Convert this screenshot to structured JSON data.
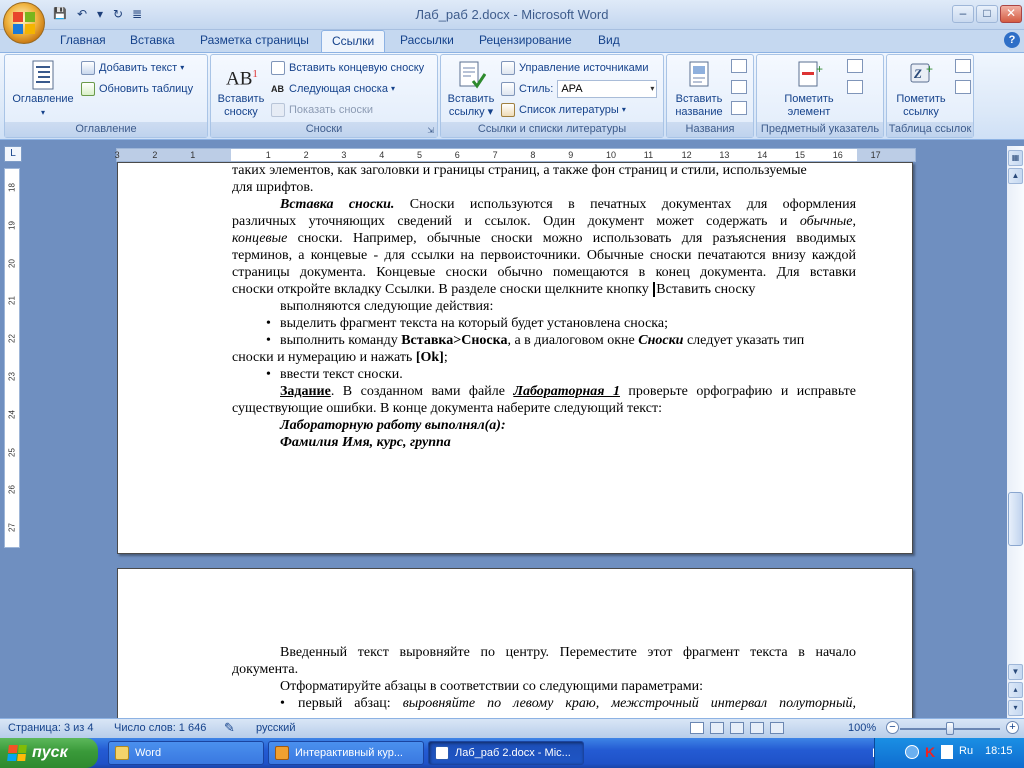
{
  "window": {
    "title": "Лаб_раб 2.docx - Microsoft Word",
    "minimize": "–",
    "maximize": "□",
    "close": "✕"
  },
  "qat": {
    "save": "💾",
    "undo": "↶",
    "dropdown": "▾",
    "redo": "↻",
    "customize": "≣"
  },
  "tabs": [
    "Главная",
    "Вставка",
    "Разметка страницы",
    "Ссылки",
    "Рассылки",
    "Рецензирование",
    "Вид"
  ],
  "active_tab": "Ссылки",
  "ribbon": {
    "toc": {
      "label": "Оглавление",
      "big": "Оглавление",
      "add_text": "Добавить текст",
      "update": "Обновить таблицу"
    },
    "footnotes": {
      "label": "Сноски",
      "insert_line1": "Вставить",
      "insert_line2": "сноску",
      "ab_glyph": "AB",
      "ab_sup": "1",
      "endnote": "Вставить концевую сноску",
      "next": "Следующая сноска",
      "show": "Показать сноски"
    },
    "citations": {
      "label": "Ссылки и списки литературы",
      "insert_line1": "Вставить",
      "insert_line2": "ссылку",
      "manage": "Управление источниками",
      "style_label": "Стиль:",
      "style_value": "APA",
      "bibliography": "Список литературы"
    },
    "captions": {
      "label": "Названия",
      "insert_line1": "Вставить",
      "insert_line2": "название"
    },
    "index": {
      "label": "Предметный указатель",
      "mark_line1": "Пометить",
      "mark_line2": "элемент"
    },
    "toa": {
      "label": "Таблица ссылок",
      "mark_line1": "Пометить",
      "mark_line2": "ссылку"
    }
  },
  "ruler": {
    "corner": "L",
    "marks": [
      "3",
      "2",
      "1",
      "1",
      "2",
      "3",
      "4",
      "5",
      "6",
      "7",
      "8",
      "9",
      "10",
      "11",
      "12",
      "13",
      "14",
      "15",
      "16",
      "17"
    ],
    "vmarks": [
      "18",
      "19",
      "20",
      "21",
      "22",
      "23",
      "24",
      "25",
      "26",
      "27"
    ]
  },
  "page1": {
    "lines": [
      "таких элементов, как заголовки и границы страниц, а также фон страниц и стили, используемые",
      "для шрифтов."
    ],
    "p_vstavka": {
      "lead": "Вставка сноски.",
      "rest": " Сноски используются в печатных документах для оформления",
      "l2_a": "различных уточняющих сведений и ссылок. Один документ может содержать и ",
      "l2_b": "обычные",
      "l2_c": ",",
      "l3_a": "концевые",
      "l3_b": " сноски. Например, обычные сноски можно использовать для разъяснения вводимых",
      "l4": "терминов, а концевые - для ссылки на первоисточники. Обычные сноски печатаются внизу каждой",
      "l5": "страницы документа. Концевые сноски обычно помещаются в конец документа. Для вставки",
      "l6": "сноски откройте вкладку Ссылки. В разделе сноски щелкните кнопку ",
      "l6_b": "Вставить сноску",
      "l7": "выполняются следующие действия:"
    },
    "b1": "выделить фрагмент текста на который будет установлена сноска;",
    "b2": {
      "a": "выполнить команду ",
      "b": "Вставка>Сноска",
      "c": ", а в диалоговом окне ",
      "d": "Сноски",
      "e": " следует указать тип"
    },
    "b2_cont": {
      "a": "сноски и нумерацию и нажать ",
      "b": "[Ok]",
      "c": ";"
    },
    "b3": "ввести текст сноски.",
    "task": {
      "lead": "Задание",
      "a": ". В созданном вами файле ",
      "b": "Лабораторная 1",
      "c": " проверьте орфографию и исправьте",
      "l2": "существующие ошибки. В конце документа наберите следующий текст:"
    },
    "sig1": "Лабораторную работу выполнял(а):",
    "sig2": "Фамилия Имя, курс, группа"
  },
  "page2": {
    "l1": "Введенный текст выровняйте по центру. Переместите этот фрагмент текста в начало",
    "l2": "документа.",
    "l3": "Отформатируйте абзацы в соответствии со следующими параметрами:",
    "b1_a": "первый абзац: ",
    "b1_b": "выровняйте по левому краю, межстрочный интервал полуторный,"
  },
  "status": {
    "page": "Страница: 3 из 4",
    "words": "Число слов: 1 646",
    "lang": "русский",
    "zoom": "100%",
    "zoom_minus": "−",
    "zoom_plus": "+"
  },
  "taskbar": {
    "start": "пуск",
    "tasks": [
      "Word",
      "Интерактивный кур...",
      "Лаб_раб 2.docx - Mic..."
    ],
    "lang": "RU",
    "tray_lang": "Ru",
    "time": "18:15"
  }
}
